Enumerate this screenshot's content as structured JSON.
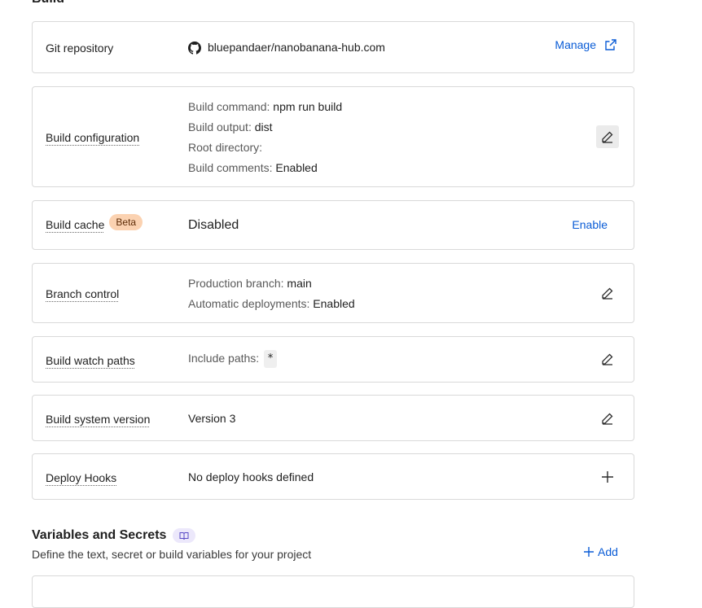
{
  "section": {
    "title": "Build"
  },
  "git": {
    "label": "Git repository",
    "repo": "bluepandaer/nanobanana-hub.com",
    "manage_label": "Manage"
  },
  "build_config": {
    "label": "Build configuration",
    "rows": [
      {
        "key": "Build command:",
        "value": "npm run build"
      },
      {
        "key": "Build output:",
        "value": "dist"
      },
      {
        "key": "Root directory:",
        "value": ""
      },
      {
        "key": "Build comments:",
        "value": "Enabled"
      }
    ]
  },
  "build_cache": {
    "label": "Build cache",
    "badge": "Beta",
    "status": "Disabled",
    "enable_label": "Enable"
  },
  "branch_control": {
    "label": "Branch control",
    "rows": [
      {
        "key": "Production branch:",
        "value": "main"
      },
      {
        "key": "Automatic deployments:",
        "value": "Enabled"
      }
    ]
  },
  "watch_paths": {
    "label": "Build watch paths",
    "key": "Include paths:",
    "value": "*"
  },
  "system_version": {
    "label": "Build system version",
    "value": "Version 3"
  },
  "deploy_hooks": {
    "label": "Deploy Hooks",
    "value": "No deploy hooks defined"
  },
  "variables": {
    "title": "Variables and Secrets",
    "description": "Define the text, secret or build variables for your project",
    "add_label": "Add"
  },
  "colors": {
    "link": "#0a5cd6",
    "badge_bg": "#fbd2b1",
    "border": "#d9d9d9"
  },
  "icons": [
    "github-icon",
    "external-link-icon",
    "pencil-icon",
    "plus-icon",
    "book-icon"
  ]
}
